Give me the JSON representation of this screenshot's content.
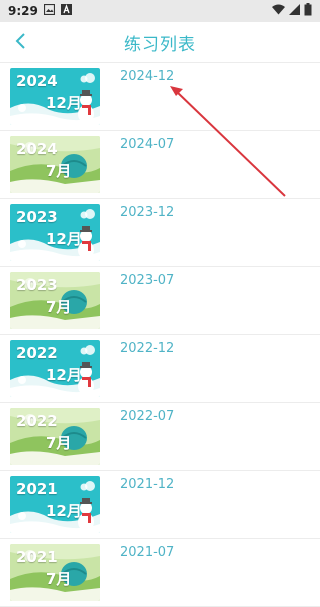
{
  "status": {
    "time": "9:29"
  },
  "header": {
    "title": "练习列表"
  },
  "items": [
    {
      "label": "2024-12",
      "year": "2024",
      "month": "12月",
      "theme": "winter"
    },
    {
      "label": "2024-07",
      "year": "2024",
      "month": "7月",
      "theme": "summer"
    },
    {
      "label": "2023-12",
      "year": "2023",
      "month": "12月",
      "theme": "winter"
    },
    {
      "label": "2023-07",
      "year": "2023",
      "month": "7月",
      "theme": "summer"
    },
    {
      "label": "2022-12",
      "year": "2022",
      "month": "12月",
      "theme": "winter"
    },
    {
      "label": "2022-07",
      "year": "2022",
      "month": "7月",
      "theme": "summer"
    },
    {
      "label": "2021-12",
      "year": "2021",
      "month": "12月",
      "theme": "winter"
    },
    {
      "label": "2021-07",
      "year": "2021",
      "month": "7月",
      "theme": "summer"
    }
  ],
  "colors": {
    "accent": "#3ab8c8",
    "annotation": "#d9363e"
  }
}
